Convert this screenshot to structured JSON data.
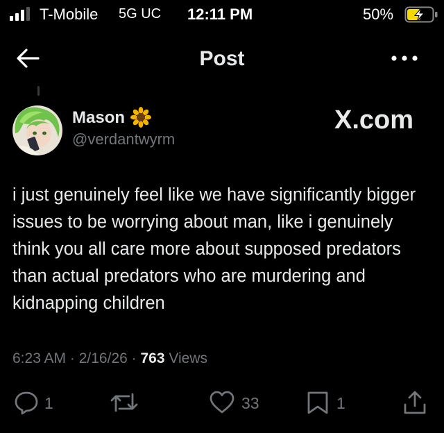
{
  "status_bar": {
    "carrier": "T-Mobile",
    "network": "5G UC",
    "time": "12:11 PM",
    "battery_percent": "50%"
  },
  "nav": {
    "title": "Post",
    "back_icon": "arrow-left-icon",
    "more_icon": "more-horizontal-icon"
  },
  "post": {
    "author": {
      "display_name": "Mason",
      "name_emoji": "sunflower-icon",
      "handle": "@verdantwyrm"
    },
    "watermark": "X.com",
    "text": "i just genuinely feel like we have significantly bigger issues to be worrying about man, like i genuinely think you all care more about supposed predators than actual predators who are murdering and kidnapping children",
    "time": "6:23 AM",
    "date": "2/16/26",
    "views_count": "763",
    "views_label": "Views"
  },
  "actions": {
    "reply_count": "1",
    "repost_count": "",
    "like_count": "33",
    "bookmark_count": "1"
  },
  "colors": {
    "background": "#000000",
    "text_primary": "#e7e9ea",
    "text_secondary": "#71767b",
    "battery_fill": "#f5d800"
  }
}
